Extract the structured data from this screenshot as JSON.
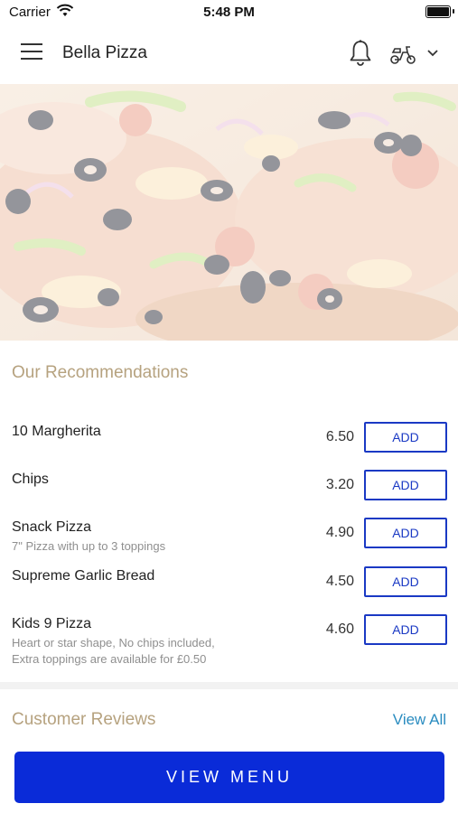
{
  "status_bar": {
    "carrier": "Carrier",
    "time": "5:48 PM"
  },
  "header": {
    "title": "Bella Pizza",
    "icons": [
      "menu-icon",
      "bell-icon",
      "scooter-icon",
      "chevron-down-icon"
    ]
  },
  "hero": {
    "image": "pizza-photo"
  },
  "recommendations": {
    "title": "Our Recommendations",
    "add_label": "ADD",
    "items": [
      {
        "name": "10 Margherita",
        "desc1": "",
        "desc2": "",
        "price": "6.50"
      },
      {
        "name": "Chips",
        "desc1": "",
        "desc2": "",
        "price": "3.20"
      },
      {
        "name": "Snack Pizza",
        "desc1": "7\" Pizza with up to 3 toppings",
        "desc2": "",
        "price": "4.90"
      },
      {
        "name": "Supreme Garlic Bread",
        "desc1": "",
        "desc2": "",
        "price": "4.50"
      },
      {
        "name": "Kids 9 Pizza",
        "desc1": "Heart or star shape, No chips included,",
        "desc2": "Extra toppings are available for £0.50",
        "price": "4.60"
      }
    ]
  },
  "reviews": {
    "title": "Customer Reviews",
    "view_all": "View All"
  },
  "footer": {
    "view_menu": "VIEW MENU"
  },
  "colors": {
    "accent_blue": "#0a2bd8",
    "button_outline": "#1a39c4",
    "section_title": "#b6a27f",
    "link": "#2a8cc0"
  }
}
